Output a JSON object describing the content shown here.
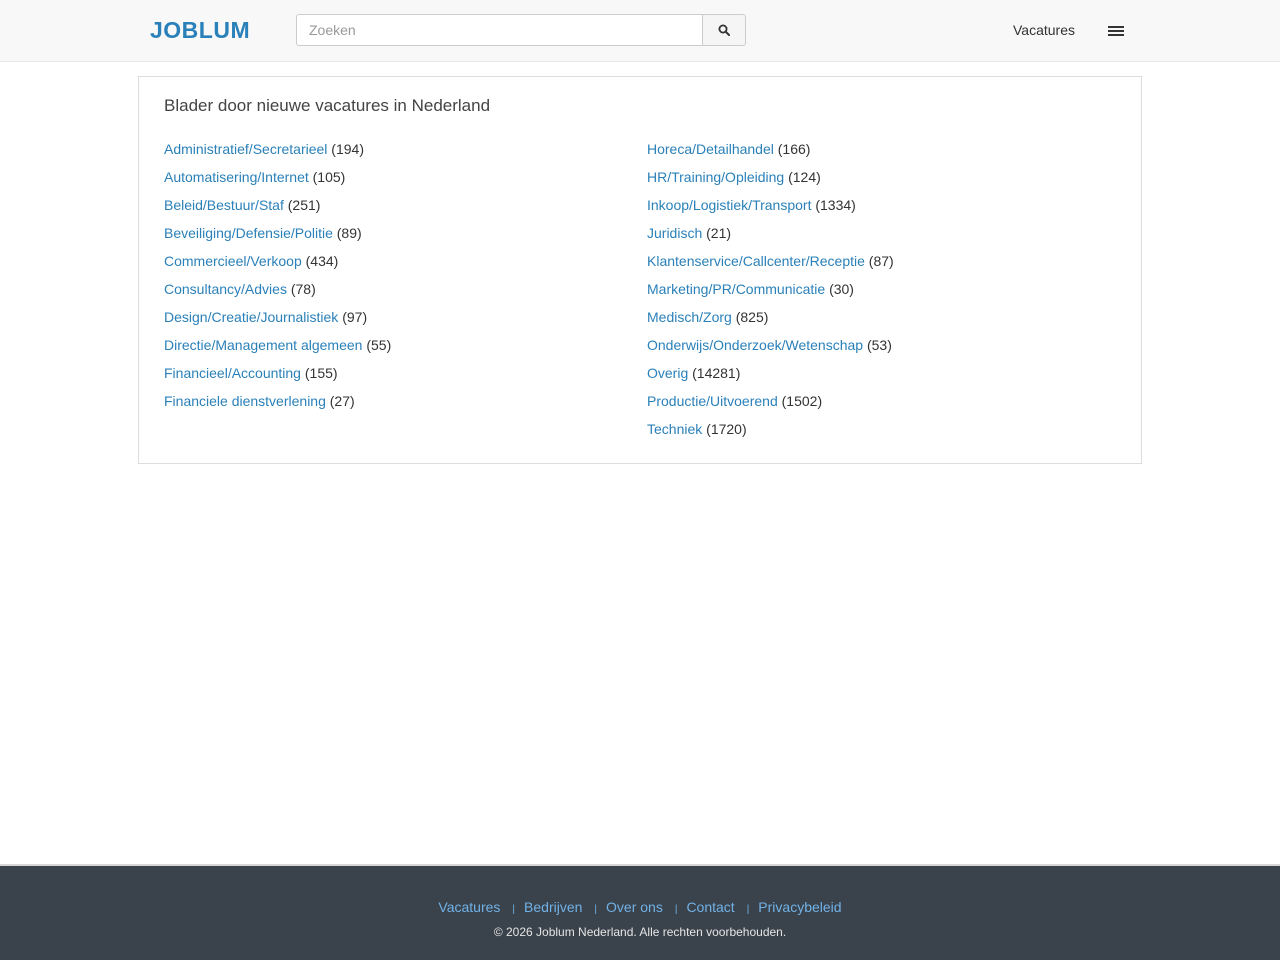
{
  "header": {
    "logo": "JOBLUM",
    "search_placeholder": "Zoeken",
    "search_value": "",
    "nav_link": "Vacatures"
  },
  "panel": {
    "title": "Blader door nieuwe vacatures in Nederland",
    "left_categories": [
      {
        "name": "Administratief/Secretarieel",
        "count": "(194)"
      },
      {
        "name": "Automatisering/Internet",
        "count": "(105)"
      },
      {
        "name": "Beleid/Bestuur/Staf",
        "count": "(251)"
      },
      {
        "name": "Beveiliging/Defensie/Politie",
        "count": "(89)"
      },
      {
        "name": "Commercieel/Verkoop",
        "count": "(434)"
      },
      {
        "name": "Consultancy/Advies",
        "count": "(78)"
      },
      {
        "name": "Design/Creatie/Journalistiek",
        "count": "(97)"
      },
      {
        "name": "Directie/Management algemeen",
        "count": "(55)"
      },
      {
        "name": "Financieel/Accounting",
        "count": "(155)"
      },
      {
        "name": "Financiele dienstverlening",
        "count": "(27)"
      }
    ],
    "right_categories": [
      {
        "name": "Horeca/Detailhandel",
        "count": "(166)"
      },
      {
        "name": "HR/Training/Opleiding",
        "count": "(124)"
      },
      {
        "name": "Inkoop/Logistiek/Transport",
        "count": "(1334)"
      },
      {
        "name": "Juridisch",
        "count": "(21)"
      },
      {
        "name": "Klantenservice/Callcenter/Receptie",
        "count": "(87)"
      },
      {
        "name": "Marketing/PR/Communicatie",
        "count": "(30)"
      },
      {
        "name": "Medisch/Zorg",
        "count": "(825)"
      },
      {
        "name": "Onderwijs/Onderzoek/Wetenschap",
        "count": "(53)"
      },
      {
        "name": "Overig",
        "count": "(14281)"
      },
      {
        "name": "Productie/Uitvoerend",
        "count": "(1502)"
      },
      {
        "name": "Techniek",
        "count": "(1720)"
      }
    ]
  },
  "footer": {
    "links": [
      "Vacatures",
      "Bedrijven",
      "Over ons",
      "Contact",
      "Privacybeleid"
    ],
    "separator": "|",
    "copyright": "© 2026 Joblum Nederland. Alle rechten voorbehouden."
  },
  "icons": {
    "search": "search-icon",
    "menu": "hamburger-menu-icon"
  },
  "colors": {
    "brand": "#2a80b9",
    "link": "#2a80b9",
    "footer_bg": "#3a424b",
    "footer_link": "#71b2e6"
  }
}
